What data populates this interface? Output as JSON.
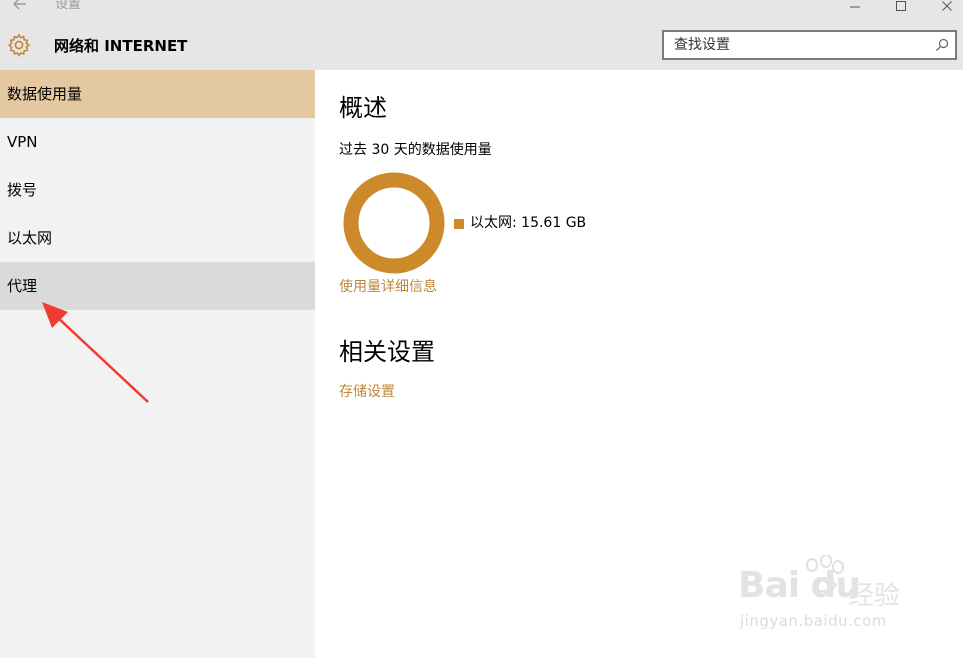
{
  "window": {
    "title": "设置",
    "minimize_icon": "minimize-icon",
    "maximize_icon": "maximize-icon",
    "close_icon": "close-icon",
    "back_icon": "back-arrow-icon"
  },
  "header": {
    "icon": "gear-icon",
    "title": "网络和 INTERNET",
    "search_placeholder": "查找设置",
    "search_icon": "search-icon"
  },
  "sidebar": {
    "items": [
      {
        "label": "数据使用量",
        "state": "selected"
      },
      {
        "label": "VPN",
        "state": "normal"
      },
      {
        "label": "拨号",
        "state": "normal"
      },
      {
        "label": "以太网",
        "state": "normal"
      },
      {
        "label": "代理",
        "state": "hover"
      }
    ]
  },
  "main": {
    "overview_title": "概述",
    "usage_caption": "过去 30 天的数据使用量",
    "legend": {
      "label": "以太网: 15.61 GB",
      "color": "#cc8a2a"
    },
    "usage_share": 1.0,
    "details_link": "使用量详细信息",
    "related_title": "相关设置",
    "storage_link": "存储设置"
  },
  "colors": {
    "accent": "#c0873a",
    "selected_bg": "#e4c8a1",
    "hover_bg": "#dadada",
    "sidebar_bg": "#f2f2f2",
    "header_bg": "#e6e6e6",
    "annotation_arrow": "#f03c30"
  },
  "watermark": {
    "brand": "Bai du",
    "brand_suffix": "经验",
    "url": "jingyan.baidu.com"
  }
}
